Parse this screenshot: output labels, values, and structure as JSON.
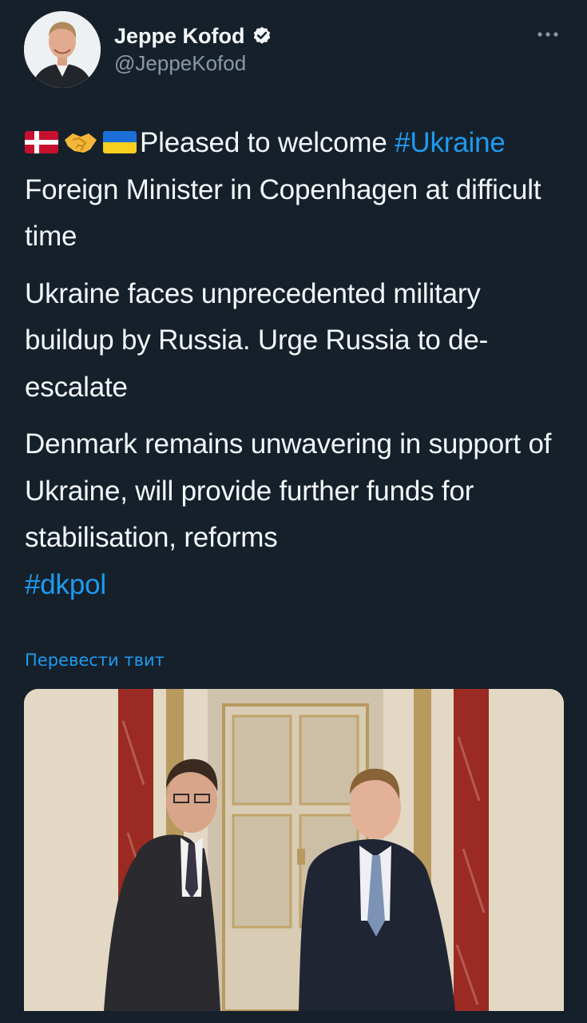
{
  "author": {
    "display_name": "Jeppe Kofod",
    "handle": "@JeppeKofod",
    "verified": true,
    "avatar_icon": "profile-photo"
  },
  "tweet": {
    "emoji_prefix": [
      "denmark-flag",
      "handshake",
      "ukraine-flag"
    ],
    "para1_text": "Pleased to welcome ",
    "para1_hashtag": "#Ukraine",
    "para1_rest": "Foreign Minister in Copenhagen at difficult time",
    "para2": "Ukraine faces unprecedented military buildup by Russia. Urge Russia to de-escalate",
    "para3": "Denmark remains unwavering in support of Ukraine, will provide further funds for stabilisation, reforms",
    "hashtag2": "#dkpol"
  },
  "translate_label": "Перевести твит",
  "menu_icon": "more-dots-icon",
  "colors": {
    "background": "#15202b",
    "text": "#f5f8fa",
    "secondary": "#8b98a5",
    "accent": "#1d9bf0"
  }
}
